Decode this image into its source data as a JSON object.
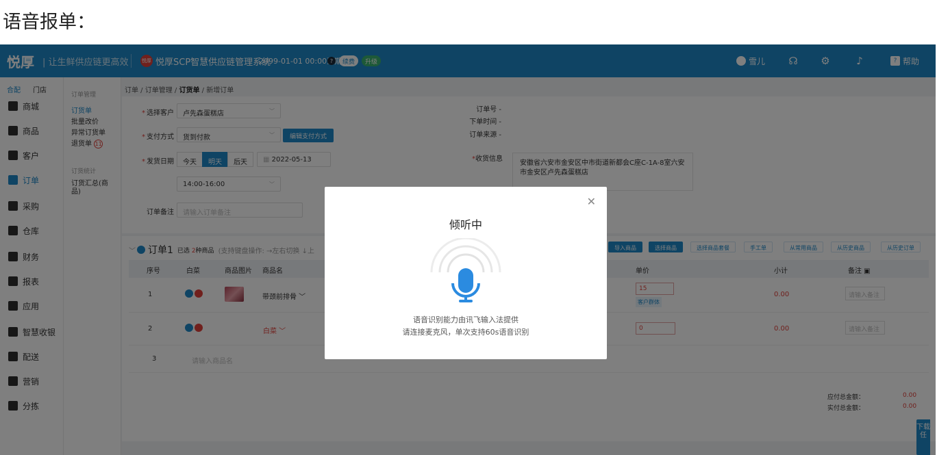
{
  "page_heading": "语音报单：",
  "header": {
    "logo": "悦厚",
    "slogan": "| 让生鲜供应链更高效",
    "brand_badge": "悦厚",
    "system_name": "悦厚SCP智慧供应链管理系统",
    "expiry": "2099-01-01 00:00到期",
    "renew_label": "续费",
    "upgrade_label": "升级",
    "user_name": "雪儿",
    "help_label": "帮助",
    "brand_color": "#1e88c8"
  },
  "sidebar": {
    "tabs": [
      "合配",
      "门店"
    ],
    "items": [
      {
        "label": "商城",
        "icon": "store-icon"
      },
      {
        "label": "商品",
        "icon": "goods-icon"
      },
      {
        "label": "客户",
        "icon": "customer-icon"
      },
      {
        "label": "订单",
        "icon": "order-icon"
      },
      {
        "label": "采购",
        "icon": "purchase-icon"
      },
      {
        "label": "仓库",
        "icon": "warehouse-icon"
      },
      {
        "label": "财务",
        "icon": "finance-icon"
      },
      {
        "label": "报表",
        "icon": "report-icon"
      },
      {
        "label": "应用",
        "icon": "cloud-icon"
      },
      {
        "label": "智慧收银",
        "icon": "cashier-icon"
      },
      {
        "label": "配送",
        "icon": "truck-icon"
      },
      {
        "label": "营销",
        "icon": "marketing-icon"
      },
      {
        "label": "分拣",
        "icon": "scale-icon"
      }
    ]
  },
  "subbar": {
    "group1": "订单管理",
    "links1": [
      "订货单",
      "批量改价",
      "异常订货单",
      "退货单"
    ],
    "return_badge": "11",
    "group2": "订货统计",
    "links2": [
      "订货汇总(商品)"
    ]
  },
  "breadcrumb": {
    "p1": "订单",
    "p2": "订单管理",
    "p3": "订货单",
    "p4": "新增订单"
  },
  "form": {
    "customer_label": "选择客户",
    "customer_value": "卢先森蛋糕店",
    "payment_label": "支付方式",
    "payment_value": "货到付款",
    "edit_payment_btn": "编辑支付方式",
    "ship_date_label": "发货日期",
    "date_today": "今天",
    "date_tomorrow": "明天",
    "date_after": "后天",
    "date_value": "2022-05-13",
    "time_value": "14:00-16:00",
    "remark_label": "订单备注",
    "remark_placeholder": "请输入订单备注",
    "order_no_label": "订单号",
    "order_no_value": "-",
    "order_time_label": "下单时间",
    "order_time_value": "-",
    "order_source_label": "订单来源",
    "order_source_value": "-",
    "address_label": "收货信息",
    "address_value": "安徽省六安市金安区中市街道新都会C座C-1A-8室六安市金安区卢先森蛋糕店"
  },
  "order": {
    "title": "订单1",
    "selected_prefix": "已选",
    "selected_count": "2",
    "selected_suffix": "种商品",
    "hint": "(支持键盘操作: →左右切换  ↓上",
    "buttons": [
      "导入商品",
      "选择商品",
      "选择商品套餐",
      "手工单",
      "从常用商品",
      "从历史商品",
      "从历史订单"
    ],
    "columns": {
      "seq": "序号",
      "cabbage": "白菜",
      "image": "商品图片",
      "name": "商品名",
      "price": "单价",
      "subtotal": "小计",
      "note": "备注"
    },
    "rows": [
      {
        "seq": "1",
        "name": "带颈前排骨",
        "price": "15",
        "price_tag": "客户群体",
        "subtotal": "0.00",
        "note_placeholder": "请输入备注"
      },
      {
        "seq": "2",
        "name": "白菜",
        "price": "0",
        "subtotal": "0.00",
        "note_placeholder": "请输入备注"
      },
      {
        "seq": "3",
        "name_placeholder": "请输入商品名"
      }
    ],
    "payable_label": "应付总金额：",
    "payable_value": "0.00",
    "actual_label": "实付总金额：",
    "actual_value": "0.00"
  },
  "download_tab": "下载任",
  "modal": {
    "title": "倾听中",
    "line1": "语音识别能力由讯飞输入法提供",
    "line2": "请连接麦克风，单次支持60s语音识别",
    "accent_color": "#1e88c8"
  }
}
